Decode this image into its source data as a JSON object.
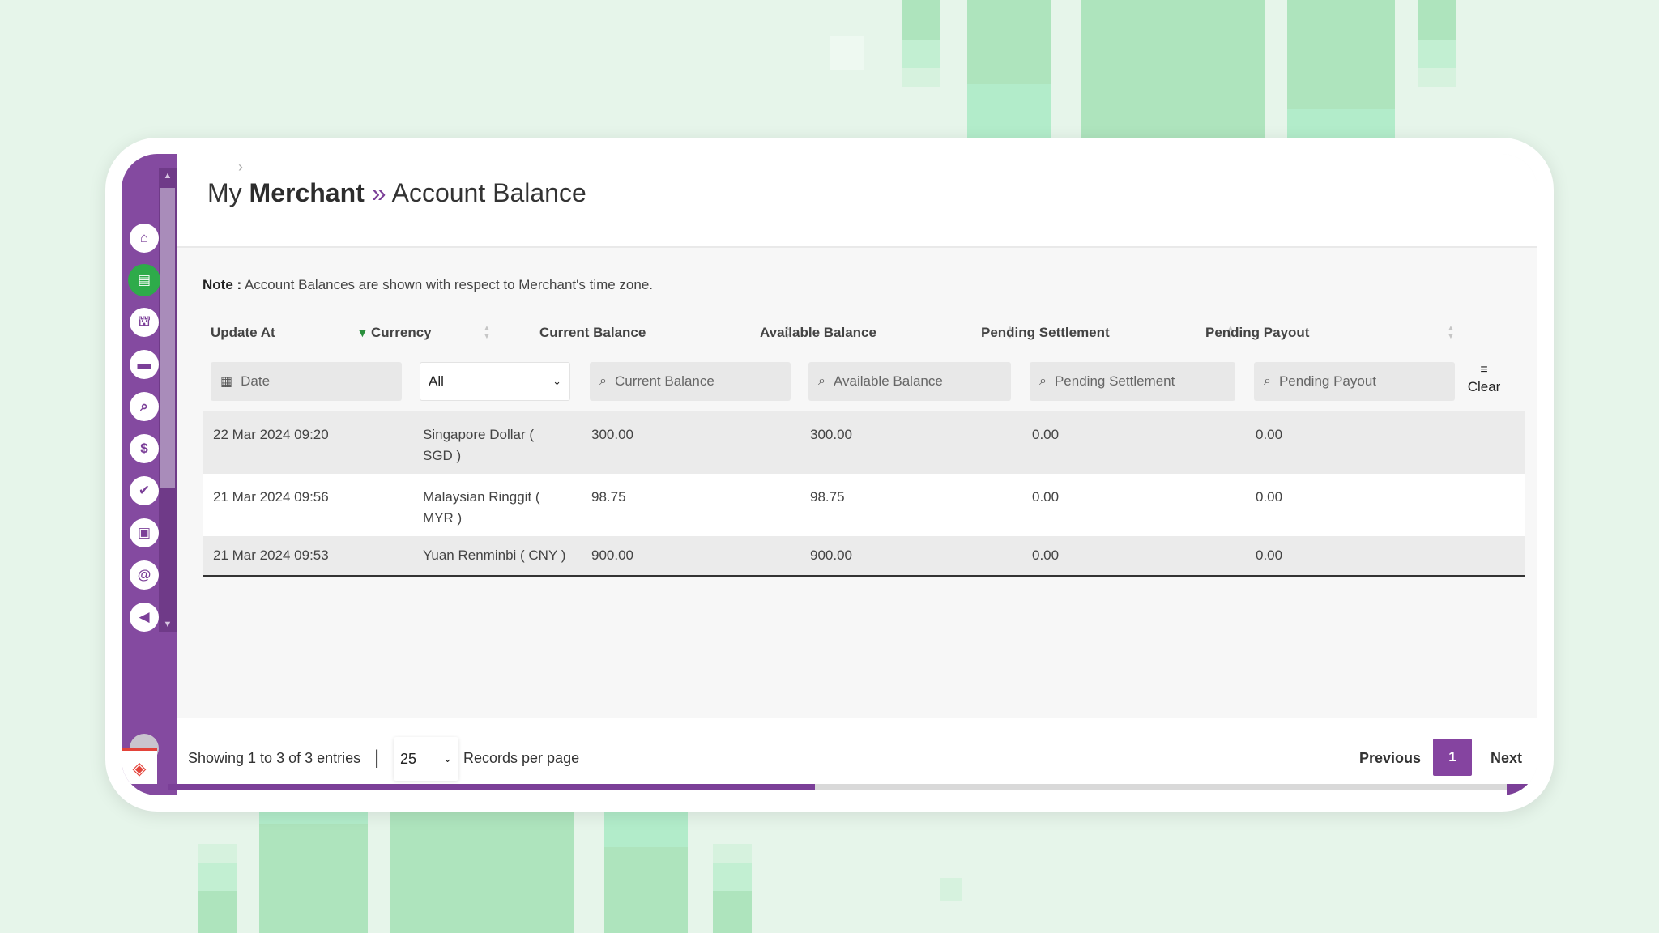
{
  "breadcrumb": {
    "part1": "My",
    "part2": "Merchant",
    "separator": "»",
    "part3": "Account Balance"
  },
  "note": {
    "label": "Note :",
    "text": "Account Balances are shown with respect to Merchant's time zone."
  },
  "sidebar": {
    "icons": [
      "home-icon",
      "store-icon",
      "bank-icon",
      "wallet-icon",
      "search-money-icon",
      "dollar-chat-icon",
      "check-icon",
      "cash-icon",
      "at-icon",
      "megaphone-icon"
    ],
    "active": "store-icon"
  },
  "table": {
    "columns": [
      {
        "key": "update_at",
        "label": "Update At"
      },
      {
        "key": "currency",
        "label": "Currency"
      },
      {
        "key": "current_balance",
        "label": "Current Balance"
      },
      {
        "key": "available_balance",
        "label": "Available Balance"
      },
      {
        "key": "pending_settlement",
        "label": "Pending Settlement"
      },
      {
        "key": "pending_payout",
        "label": "Pending Payout"
      }
    ],
    "filters": {
      "date_placeholder": "Date",
      "currency_selected": "All",
      "current_balance_placeholder": "Current Balance",
      "available_balance_placeholder": "Available Balance",
      "pending_settlement_placeholder": "Pending Settlement",
      "pending_payout_placeholder": "Pending Payout",
      "clear_label": "Clear"
    },
    "rows": [
      {
        "update_at": "22 Mar 2024 09:20",
        "currency_line1": "Singapore Dollar (",
        "currency_line2": "SGD )",
        "current_balance": "300.00",
        "available_balance": "300.00",
        "pending_settlement": "0.00",
        "pending_payout": "0.00"
      },
      {
        "update_at": "21 Mar 2024 09:56",
        "currency_line1": "Malaysian Ringgit (",
        "currency_line2": "MYR )",
        "current_balance": "98.75",
        "available_balance": "98.75",
        "pending_settlement": "0.00",
        "pending_payout": "0.00"
      },
      {
        "update_at": "21 Mar 2024 09:53",
        "currency_line1": "Yuan Renminbi ( CNY )",
        "currency_line2": "",
        "current_balance": "900.00",
        "available_balance": "900.00",
        "pending_settlement": "0.00",
        "pending_payout": "0.00"
      }
    ]
  },
  "footer": {
    "showing": "Showing 1 to 3 of 3 entries",
    "separator": "|",
    "per_page": "25",
    "per_page_label": "Records per page",
    "previous": "Previous",
    "current_page": "1",
    "next": "Next"
  },
  "colors": {
    "brand_purple": "#844aa0",
    "active_green": "#2eab4a",
    "background_mint": "#e6f5ea"
  }
}
